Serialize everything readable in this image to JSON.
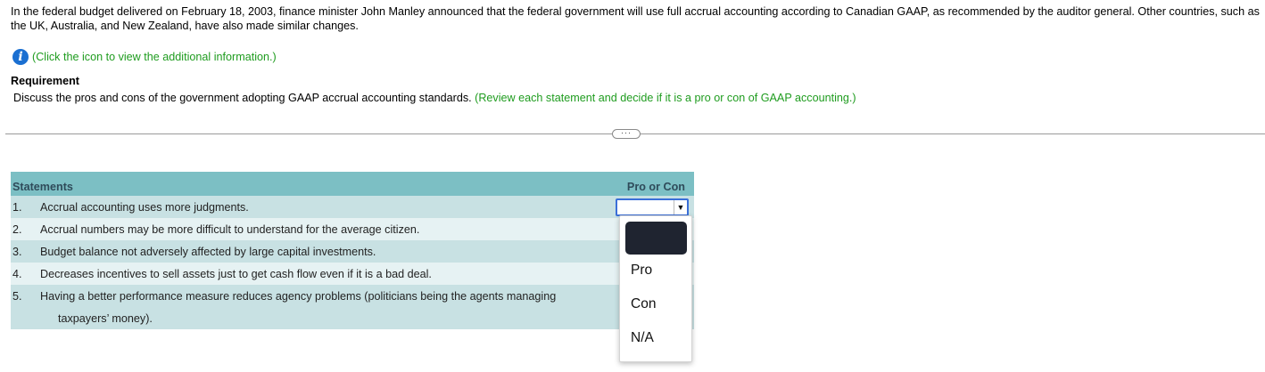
{
  "intro": {
    "text": "In the federal budget delivered on February 18, 2003, finance minister John Manley announced that the federal government will use full accrual accounting according to Canadian GAAP, as recommended by the auditor general. Other countries, such as the UK, Australia, and New Zealand, have also made similar changes."
  },
  "info": {
    "icon": "info-icon",
    "link": "(Click the icon to view the additional information.)"
  },
  "requirement": {
    "title": "Requirement",
    "text": "Discuss the pros and cons of the government adopting GAAP accrual accounting standards.",
    "hint": "(Review each statement and decide if it is a pro or con of GAAP accounting.)"
  },
  "divider_handle": "···",
  "table": {
    "header_statements": "Statements",
    "header_pro_con": "Pro or Con",
    "rows": [
      {
        "num": "1.",
        "text": "Accrual accounting uses more judgments."
      },
      {
        "num": "2.",
        "text": "Accrual numbers may be more difficult to understand for the average citizen."
      },
      {
        "num": "3.",
        "text": "Budget balance not adversely affected by large capital investments."
      },
      {
        "num": "4.",
        "text": "Decreases incentives to sell assets just to get cash flow even if it is a bad deal."
      },
      {
        "num": "5.",
        "text": "Having a better performance measure reduces agency problems (politicians being the agents managing",
        "cont": "taxpayers’ money)."
      }
    ],
    "select_value": "",
    "arrow": "▼"
  },
  "dropdown": {
    "options": [
      "Pro",
      "Con",
      "N/A"
    ]
  },
  "colors": {
    "header_bg": "#7cbfc4",
    "row_dark": "#c8e1e3",
    "row_light": "#e6f2f3",
    "green_text": "#1f9c1f",
    "focus_border": "#3b6fd8"
  }
}
